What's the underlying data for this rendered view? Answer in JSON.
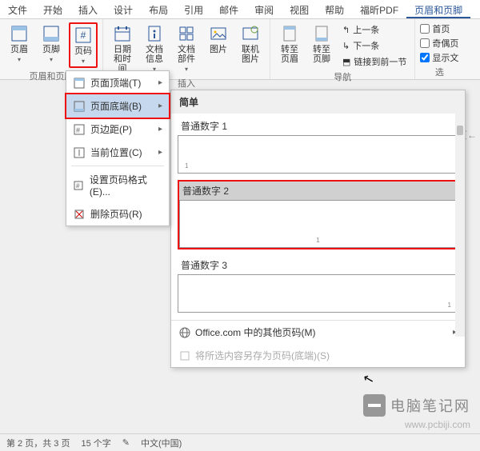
{
  "tabs": {
    "file": "文件",
    "home": "开始",
    "insert": "插入",
    "design": "设计",
    "layout": "布局",
    "references": "引用",
    "mail": "邮件",
    "review": "审阅",
    "view": "视图",
    "help": "帮助",
    "foxit": "福昕PDF",
    "header_footer": "页眉和页脚"
  },
  "ribbon": {
    "header": "页眉",
    "footer": "页脚",
    "page_number": "页码",
    "date_time": "日期和时间",
    "doc_info": "文档信息",
    "doc_parts": "文档部件",
    "picture": "图片",
    "online_picture": "联机图片",
    "goto_header": "转至页眉",
    "goto_footer": "转至页脚",
    "prev": "上一条",
    "next": "下一条",
    "link_prev": "链接到前一节",
    "first_diff": "首页",
    "odd_even": "奇偶页",
    "show_text": "显示文",
    "group_hf": "页眉和页脚",
    "group_insert": "插入",
    "group_nav": "导航",
    "group_opt": "选"
  },
  "menu": {
    "top": "页面顶端(T)",
    "bottom": "页面底端(B)",
    "margin": "页边距(P)",
    "current": "当前位置(C)",
    "format": "设置页码格式(E)...",
    "remove": "删除页码(R)"
  },
  "submenu": {
    "header": "简单",
    "item1": "普通数字 1",
    "item2": "普通数字 2",
    "item3": "普通数字 3",
    "office_more": "Office.com 中的其他页码(M)",
    "save_selection": "将所选内容另存为页码(底端)(S)"
  },
  "doc": {
    "page_hint": "页←"
  },
  "status": {
    "page": "第 2 页，共 3 页",
    "words": "15 个字",
    "lang": "中文(中国)"
  },
  "watermark": {
    "title": "电脑笔记网",
    "url": "www.pcbiji.com"
  }
}
